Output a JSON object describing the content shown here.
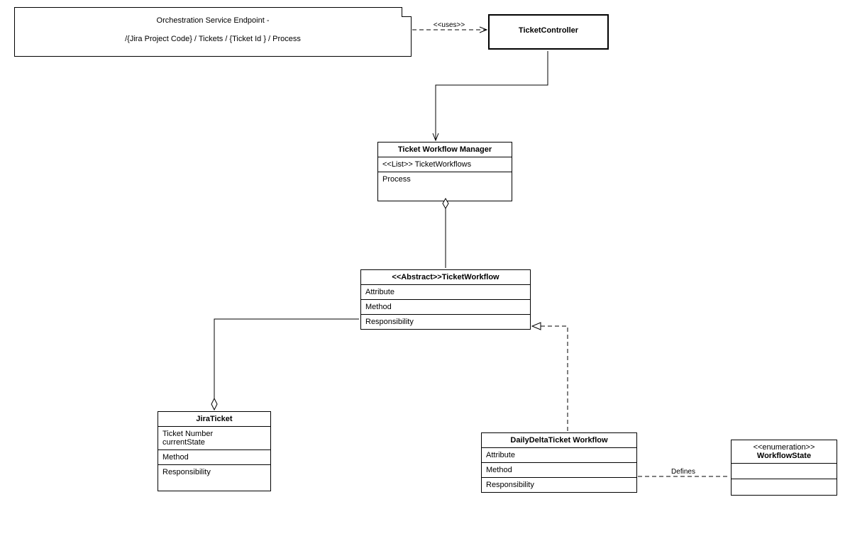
{
  "note": {
    "line1": "Orchestration Service Endpoint -",
    "line2": "/{Jira Project Code} / Tickets / {Ticket Id } / Process"
  },
  "relations": {
    "uses": "<<uses>>",
    "defines": "Defines"
  },
  "ticketController": {
    "title": "TicketController"
  },
  "workflowManager": {
    "title": "Ticket Workflow Manager",
    "attr1": "<<List>> TicketWorkflows",
    "method1": "Process"
  },
  "ticketWorkflow": {
    "title": "<<Abstract>>TicketWorkflow",
    "attr": "Attribute",
    "method": "Method",
    "resp": "Responsibility"
  },
  "jiraTicket": {
    "title": "JiraTicket",
    "attr1": "Ticket Number",
    "attr2": "currentState",
    "method": "Method",
    "resp": "Responsibility"
  },
  "dailyDelta": {
    "title": "DailyDeltaTicket Workflow",
    "attr": "Attribute",
    "method": "Method",
    "resp": "Responsibility"
  },
  "workflowState": {
    "stereo": "<<enumeration>>",
    "title": "WorkflowState"
  }
}
